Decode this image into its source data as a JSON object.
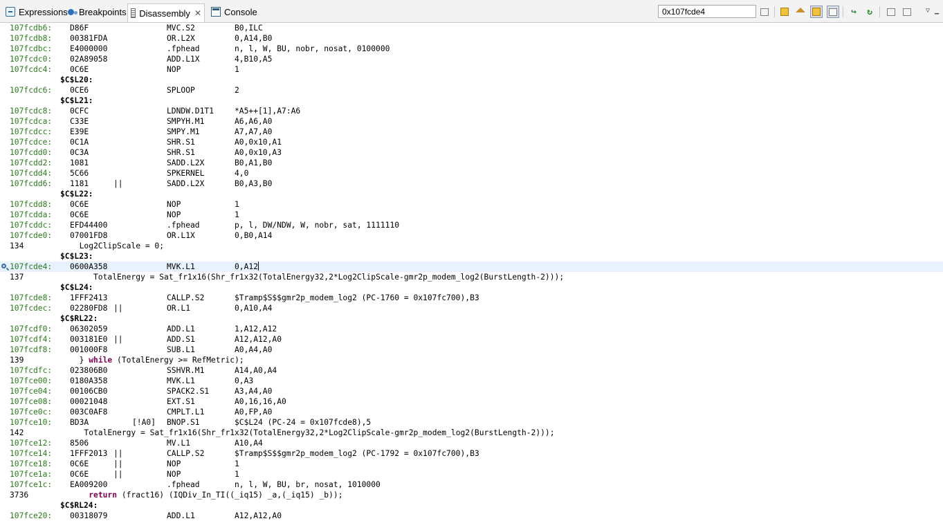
{
  "tabs": [
    {
      "label": "Expressions",
      "icon": "expressions-icon",
      "active": false
    },
    {
      "label": "Breakpoints",
      "icon": "breakpoints-icon",
      "active": false
    },
    {
      "label": "Disassembly",
      "icon": "disassembly-icon",
      "active": true,
      "close": "✕"
    },
    {
      "label": "Console",
      "icon": "console-icon",
      "active": false
    }
  ],
  "address_input": {
    "value": "0x107fcde4"
  },
  "toolbar": {
    "buttons": [
      "go-to-address",
      "refresh",
      "show-home",
      "link-with-active-debug-context",
      "show-source",
      "step-into-selection",
      "step-over",
      "new-view",
      "pin",
      "minimize",
      "maximize",
      "view-menu"
    ]
  },
  "colors": {
    "address": "#2a7a1c",
    "keyword": "#7f0055",
    "current_line": "#e8f2fe"
  },
  "disassembly": [
    {
      "t": "i",
      "addr": "107fcdb6:",
      "op": "D86F",
      "par": "",
      "mn": "MVC.S2",
      "args": "B0,ILC"
    },
    {
      "t": "i",
      "addr": "107fcdb8:",
      "op": "00381FDA",
      "par": "",
      "mn": "OR.L2X",
      "args": "0,A14,B0"
    },
    {
      "t": "i",
      "addr": "107fcdbc:",
      "op": "E4000000",
      "par": "",
      "mn": ".fphead",
      "args": "n, l, W, BU, nobr, nosat, 0100000"
    },
    {
      "t": "i",
      "addr": "107fcdc0:",
      "op": "02A89058",
      "par": "",
      "mn": "ADD.L1X",
      "args": "4,B10,A5"
    },
    {
      "t": "i",
      "addr": "107fcdc4:",
      "op": "0C6E",
      "par": "",
      "mn": "NOP",
      "args": "1"
    },
    {
      "t": "l",
      "text": "$C$L20:"
    },
    {
      "t": "i",
      "addr": "107fcdc6:",
      "op": "0CE6",
      "par": "",
      "mn": "SPLOOP",
      "args": "2"
    },
    {
      "t": "l",
      "text": "$C$L21:"
    },
    {
      "t": "i",
      "addr": "107fcdc8:",
      "op": "0CFC",
      "par": "",
      "mn": "LDNDW.D1T1",
      "args": "*A5++[1],A7:A6"
    },
    {
      "t": "i",
      "addr": "107fcdca:",
      "op": "C33E",
      "par": "",
      "mn": "SMPYH.M1",
      "args": "A6,A6,A0"
    },
    {
      "t": "i",
      "addr": "107fcdcc:",
      "op": "E39E",
      "par": "",
      "mn": "SMPY.M1",
      "args": "A7,A7,A0"
    },
    {
      "t": "i",
      "addr": "107fcdce:",
      "op": "0C1A",
      "par": "",
      "mn": "SHR.S1",
      "args": "A0,0x10,A1"
    },
    {
      "t": "i",
      "addr": "107fcdd0:",
      "op": "0C3A",
      "par": "",
      "mn": "SHR.S1",
      "args": "A0,0x10,A3"
    },
    {
      "t": "i",
      "addr": "107fcdd2:",
      "op": "1081",
      "par": "",
      "mn": "SADD.L2X",
      "args": "B0,A1,B0"
    },
    {
      "t": "i",
      "addr": "107fcdd4:",
      "op": "5C66",
      "par": "",
      "mn": "SPKERNEL",
      "args": "4,0"
    },
    {
      "t": "i",
      "addr": "107fcdd6:",
      "op": "1181",
      "par": "||",
      "mn": "SADD.L2X",
      "args": "B0,A3,B0"
    },
    {
      "t": "l",
      "text": "$C$L22:"
    },
    {
      "t": "i",
      "addr": "107fcdd8:",
      "op": "0C6E",
      "par": "",
      "mn": "NOP",
      "args": "1"
    },
    {
      "t": "i",
      "addr": "107fcdda:",
      "op": "0C6E",
      "par": "",
      "mn": "NOP",
      "args": "1"
    },
    {
      "t": "i",
      "addr": "107fcddc:",
      "op": "EFD44400",
      "par": "",
      "mn": ".fphead",
      "args": "p, l, DW/NDW, W, nobr, sat, 1111110"
    },
    {
      "t": "i",
      "addr": "107fcde0:",
      "op": "07001FD8",
      "par": "",
      "mn": "OR.L1X",
      "args": "0,B0,A14"
    },
    {
      "t": "s",
      "line": "134",
      "pre": "  Log2ClipScale = 0;",
      "kw": "",
      "post": ""
    },
    {
      "t": "l",
      "text": "$C$L23:"
    },
    {
      "t": "i",
      "addr": "107fcde4:",
      "op": "0600A358",
      "par": "",
      "mn": "MVK.L1",
      "args": "0,A12",
      "current": true
    },
    {
      "t": "s",
      "line": "137",
      "pre": "     TotalEnergy = Sat_fr1x16(Shr_fr1x32(TotalEnergy32,2*Log2ClipScale-gmr2p_modem_log2(BurstLength-2)));",
      "kw": "",
      "post": ""
    },
    {
      "t": "l",
      "text": "$C$L24:"
    },
    {
      "t": "i",
      "addr": "107fcde8:",
      "op": "1FFF2413",
      "par": "",
      "mn": "CALLP.S2",
      "args": "$Tramp$S$$gmr2p_modem_log2 (PC-1760 = 0x107fc700),B3"
    },
    {
      "t": "i",
      "addr": "107fcdec:",
      "op": "02280FD8",
      "par": "||",
      "mn": "OR.L1",
      "args": "0,A10,A4"
    },
    {
      "t": "l",
      "text": "$C$RL22:"
    },
    {
      "t": "i",
      "addr": "107fcdf0:",
      "op": "06302059",
      "par": "",
      "mn": "ADD.L1",
      "args": "1,A12,A12"
    },
    {
      "t": "i",
      "addr": "107fcdf4:",
      "op": "003181E0",
      "par": "||",
      "mn": "ADD.S1",
      "args": "A12,A12,A0"
    },
    {
      "t": "i",
      "addr": "107fcdf8:",
      "op": "001000F8",
      "par": "",
      "mn": "SUB.L1",
      "args": "A0,A4,A0"
    },
    {
      "t": "s",
      "line": "139",
      "pre": "  } ",
      "kw": "while",
      "post": " (TotalEnergy >= RefMetric);"
    },
    {
      "t": "i",
      "addr": "107fcdfc:",
      "op": "023806B0",
      "par": "",
      "mn": "SSHVR.M1",
      "args": "A14,A0,A4"
    },
    {
      "t": "i",
      "addr": "107fce00:",
      "op": "0180A358",
      "par": "",
      "mn": "MVK.L1",
      "args": "0,A3"
    },
    {
      "t": "i",
      "addr": "107fce04:",
      "op": "00106CB0",
      "par": "",
      "mn": "SPACK2.S1",
      "args": "A3,A4,A0"
    },
    {
      "t": "i",
      "addr": "107fce08:",
      "op": "00021048",
      "par": "",
      "mn": "EXT.S1",
      "args": "A0,16,16,A0"
    },
    {
      "t": "i",
      "addr": "107fce0c:",
      "op": "003C0AF8",
      "par": "",
      "mn": "CMPLT.L1",
      "args": "A0,FP,A0"
    },
    {
      "t": "i",
      "addr": "107fce10:",
      "op": "BD3A",
      "par": "[!A0]",
      "mn": "BNOP.S1",
      "args": "$C$L24 (PC-24 = 0x107fcde8),5"
    },
    {
      "t": "s",
      "line": "142",
      "pre": "   TotalEnergy = Sat_fr1x16(Shr_fr1x32(TotalEnergy32,2*Log2ClipScale-gmr2p_modem_log2(BurstLength-2)));",
      "kw": "",
      "post": ""
    },
    {
      "t": "i",
      "addr": "107fce12:",
      "op": "8506",
      "par": "",
      "mn": "MV.L1",
      "args": "A10,A4"
    },
    {
      "t": "i",
      "addr": "107fce14:",
      "op": "1FFF2013",
      "par": "||",
      "mn": "CALLP.S2",
      "args": "$Tramp$S$$gmr2p_modem_log2 (PC-1792 = 0x107fc700),B3"
    },
    {
      "t": "i",
      "addr": "107fce18:",
      "op": "0C6E",
      "par": "||",
      "mn": "NOP",
      "args": "1"
    },
    {
      "t": "i",
      "addr": "107fce1a:",
      "op": "0C6E",
      "par": "||",
      "mn": "NOP",
      "args": "1"
    },
    {
      "t": "i",
      "addr": "107fce1c:",
      "op": "EA009200",
      "par": "",
      "mn": ".fphead",
      "args": "n, l, W, BU, br, nosat, 1010000"
    },
    {
      "t": "s",
      "line": "3736",
      "pre": "    ",
      "kw": "return",
      "post": " (fract16) (IQDiv_In_TI((_iq15) _a,(_iq15) _b));"
    },
    {
      "t": "l",
      "text": "$C$RL24:"
    },
    {
      "t": "i",
      "addr": "107fce20:",
      "op": "00318079",
      "par": "",
      "mn": "ADD.L1",
      "args": "A12,A12,A0"
    }
  ]
}
